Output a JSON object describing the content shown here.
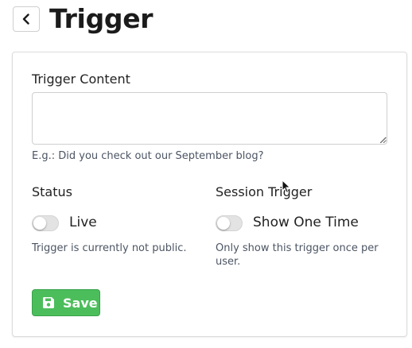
{
  "header": {
    "title": "Trigger",
    "back_icon": "chevron-left-icon"
  },
  "form": {
    "content": {
      "label": "Trigger Content",
      "value": "",
      "help": "E.g.: Did you check out our September blog?"
    },
    "status": {
      "label": "Status",
      "toggle_label": "Live",
      "enabled": false,
      "help": "Trigger is currently not public."
    },
    "session_trigger": {
      "label": "Session Trigger",
      "toggle_label": "Show One Time",
      "enabled": false,
      "help": "Only show this trigger once per user."
    },
    "save_label": "Save",
    "save_icon": "floppy-disk-icon"
  },
  "colors": {
    "save_button": "#4cbd5b",
    "toggle_off": "#e3e3e3",
    "help_text": "#4c5563"
  }
}
